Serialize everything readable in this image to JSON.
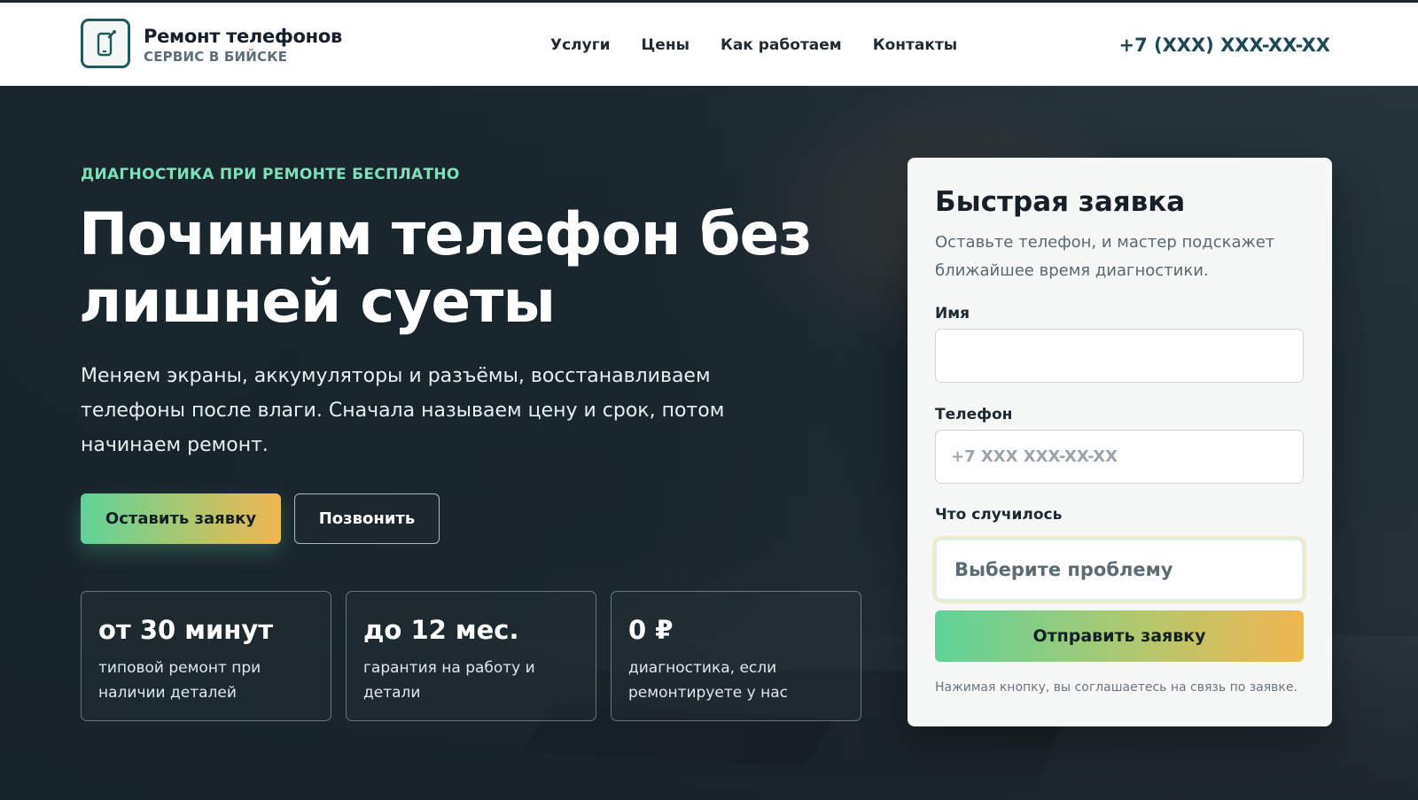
{
  "header": {
    "brand_title": "Ремонт телефонов",
    "brand_subtitle": "СЕРВИС В БИЙСКЕ",
    "logo_icon": "phone-wrench-icon",
    "nav": [
      "Услуги",
      "Цены",
      "Как работаем",
      "Контакты"
    ],
    "phone": "+7 (XXX) XXX-XX-XX"
  },
  "hero": {
    "eyebrow": "ДИАГНОСТИКА ПРИ РЕМОНТЕ БЕСПЛАТНО",
    "title_line1": "Починим телефон без",
    "title_line2": "лишней суеты",
    "text": "Меняем экраны, аккумуляторы и разъёмы, восстанавливаем телефоны после влаги. Сначала называем цену и срок, потом начинаем ремонт.",
    "primary_button": "Оставить заявку",
    "secondary_button": "Позвонить",
    "stats": [
      {
        "value": "от 30 минут",
        "desc": "типовой ремонт при наличии деталей"
      },
      {
        "value": "до 12 мес.",
        "desc": "гарантия на работу и детали"
      },
      {
        "value": "0 ₽",
        "desc": "диагностика, если ремонтируете у нас"
      }
    ]
  },
  "form": {
    "title": "Быстрая заявка",
    "subtitle": "Оставьте телефон, и мастер подскажет ближайшее время диагностики.",
    "name_label": "Имя",
    "name_value": "",
    "phone_label": "Телефон",
    "phone_placeholder": "+7 XXX XXX-XX-XX",
    "problem_label": "Что случилось",
    "problem_selected": "Выберите проблему",
    "submit": "Отправить заявку",
    "note": "Нажимая кнопку, вы соглашаетесь на связь по заявке."
  },
  "colors": {
    "accent_green": "#5ed39a",
    "accent_orange": "#f0b650",
    "eyebrow": "#7ee0b8",
    "brand_dark": "#1f5a5e"
  }
}
